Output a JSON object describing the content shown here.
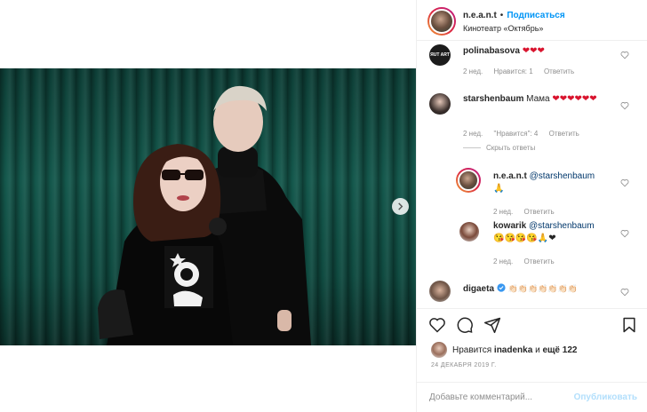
{
  "header": {
    "username": "n.e.a.n.t",
    "separator": "•",
    "follow_label": "Подписаться",
    "location": "Кинотеатр «Октябрь»"
  },
  "comments": [
    {
      "username": "polinabasova",
      "text": "",
      "emoji": "❤❤❤",
      "avatar_text": "ЯUT ART",
      "time": "2 нед.",
      "likes": "Нравится: 1",
      "reply": "Ответить"
    },
    {
      "username": "starshenbaum",
      "text": "Мама",
      "emoji": "❤❤❤❤❤❤",
      "time": "2 нед.",
      "likes": "\"Нравится\": 4",
      "reply": "Ответить",
      "hide_replies": "Скрыть ответы",
      "replies": [
        {
          "username": "n.e.a.n.t",
          "mention": "@starshenbaum",
          "emoji": "🙏",
          "time": "2 нед.",
          "reply": "Ответить"
        },
        {
          "username": "kowarik",
          "mention": "@starshenbaum",
          "emoji": "😘😘😘😘🙏❤",
          "time": "2 нед.",
          "reply": "Ответить"
        }
      ]
    },
    {
      "username": "digaeta",
      "verified": true,
      "emoji": "👏🏻👏🏻👏🏻👏🏻👏🏻👏🏻👏🏻"
    }
  ],
  "likes_line": {
    "prefix": "Нравится",
    "user": "inadenka",
    "middle": "и",
    "rest": "ещё 122"
  },
  "date": "24 ДЕКАБРЯ 2019 Г.",
  "add_comment": {
    "placeholder": "Добавьте комментарий...",
    "publish_label": "Опубликовать"
  },
  "colors": {
    "follow_blue": "#0095f6",
    "heart_red": "#d9142e",
    "publish_disabled": "#b2dffc"
  }
}
